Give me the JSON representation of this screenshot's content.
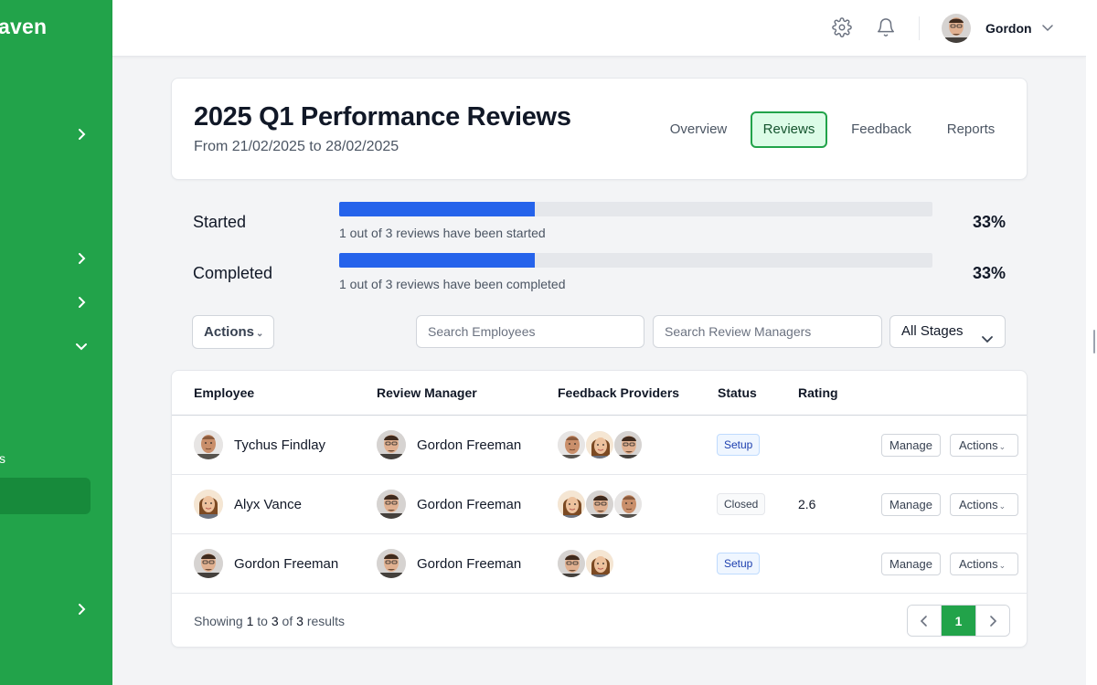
{
  "sidebar": {
    "logo_text": "aven",
    "section_letter": "s"
  },
  "header": {
    "user_name": "Gordon",
    "icons": [
      "gear-icon",
      "bell-icon",
      "chevron-down-icon"
    ]
  },
  "title_card": {
    "title": "2025 Q1 Performance Reviews",
    "subtitle": "From 21/02/2025 to 28/02/2025",
    "tabs": [
      {
        "label": "Overview",
        "active": false
      },
      {
        "label": "Reviews",
        "active": true
      },
      {
        "label": "Feedback",
        "active": false
      },
      {
        "label": "Reports",
        "active": false
      }
    ]
  },
  "progress": [
    {
      "label": "Started",
      "description": "1 out of 3 reviews have been started",
      "percent_text": "33%",
      "fraction": 0.33
    },
    {
      "label": "Completed",
      "description": "1 out of 3 reviews have been completed",
      "percent_text": "33%",
      "fraction": 0.33
    }
  ],
  "filters": {
    "actions_label": "Actions",
    "search_employees_placeholder": "Search Employees",
    "search_managers_placeholder": "Search Review Managers",
    "stage_selected": "All Stages"
  },
  "table": {
    "columns": [
      "Employee",
      "Review Manager",
      "Feedback Providers",
      "Status",
      "Rating"
    ],
    "rows": [
      {
        "employee": "Tychus Findlay",
        "employee_avatar": "male-bald",
        "manager": "Gordon Freeman",
        "providers": [
          "male-bald",
          "female",
          "male-glasses"
        ],
        "status": "Setup",
        "status_kind": "setup",
        "rating": "",
        "manage_label": "Manage",
        "actions_label": "Actions"
      },
      {
        "employee": "Alyx Vance",
        "employee_avatar": "female",
        "manager": "Gordon Freeman",
        "providers": [
          "female",
          "male-glasses",
          "male-bald"
        ],
        "status": "Closed",
        "status_kind": "closed",
        "rating": "2.6",
        "manage_label": "Manage",
        "actions_label": "Actions"
      },
      {
        "employee": "Gordon Freeman",
        "employee_avatar": "male-glasses",
        "manager": "Gordon Freeman",
        "providers": [
          "male-glasses",
          "female"
        ],
        "status": "Setup",
        "status_kind": "setup",
        "rating": "",
        "manage_label": "Manage",
        "actions_label": "Actions"
      }
    ]
  },
  "pagination": {
    "showing_prefix": "Showing",
    "from": "1",
    "to_word": "to",
    "to": "3",
    "of_word": "of",
    "total": "3",
    "results_word": "results",
    "current_page": "1"
  },
  "colors": {
    "brand": "#22a34a",
    "progress": "#2563eb"
  }
}
